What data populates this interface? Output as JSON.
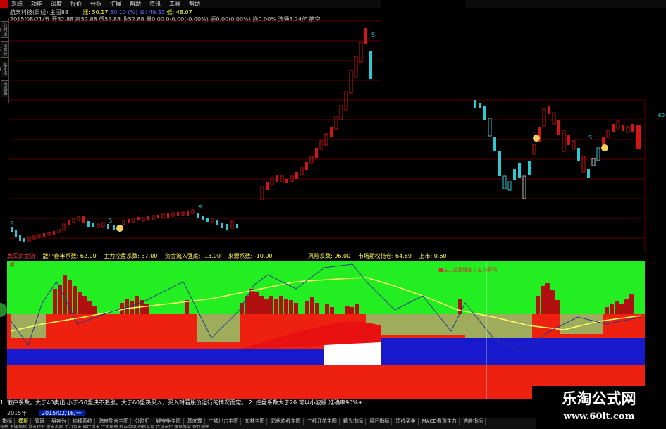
{
  "menubar": {
    "items": [
      "系统",
      "功能",
      "深度",
      "报价",
      "分析",
      "扩展",
      "帮助",
      "资讯",
      "工具",
      "帮助"
    ]
  },
  "info": {
    "title": "航天科技(日线) 主图88",
    "label_a": "涨: 50.17",
    "label_b": "50.10 (%)",
    "label_c": "高: 49.33",
    "label_d": "低: 48.07",
    "line2": "2015/08/21/五 开52.88 高52.88 低52.88 收52.88 量0.00 0-0.00(-0.00%) 振0.00(0.00%) 换0.00% 流通3.24亿 航空"
  },
  "left_tabs": [
    "分时走势",
    "技术分析",
    "基本资料",
    "自选股"
  ],
  "indicator_header": {
    "name": "真买资金流",
    "retail": "散户套牢系数: 62.00",
    "main": "主力控盘系数: 37.00",
    "inflow": "资金流入强度: -13.00",
    "trend": "来源系数: -10.00",
    "risk": "风险系数: 96.00",
    "market": "市场期权持仓: 64.69",
    "up": "上市: 0.60",
    "short_name": "筹",
    "legend": "■主力控盘强度 / 主力筹码"
  },
  "footer_note": "1. 散户系数，大于40卖出 小于-50坚决不追涨，大于60坚决买入，买入时看股价运行的情况而定。   2. 控盘系数大于20 可以小波段 准确率90%+",
  "date_row": {
    "year": "2015年",
    "date": "2015/02/16/一"
  },
  "bottom_tabs": [
    "指标",
    "模板",
    "管理",
    "另存为",
    "均线系统",
    "暗度陈仓主图",
    "分时归",
    "疑宝免主图",
    "基底算",
    "三线出击主图",
    "布林主图",
    "彩色均线主图",
    "三线开花主图",
    "精光指标",
    "风行指标",
    "短线买卖",
    "MACD看透主力",
    "选股指标"
  ],
  "bottom_row2": "指标 全面指标 资金趋势 资金追踪 主力资金 散户资金 一阳指标 综合资讯 问题反馈 仓位监控 操盘成交 换仓策略",
  "watermark": {
    "title": "乐淘公式网",
    "url": "www.60lt.com"
  },
  "side_tick": "60",
  "colors": {
    "up": "#d11515",
    "down": "#2ec8d4",
    "green_panel": "#22ee22",
    "red_panel": "#ee2010",
    "blue_bar": "#1818cc",
    "yellow_line": "#ffff66"
  },
  "chart_data": {
    "type": "candlestick",
    "x": [
      "2015/02/16",
      "2015/08/21"
    ],
    "note": "price candles followed by indicator histogram panel"
  }
}
